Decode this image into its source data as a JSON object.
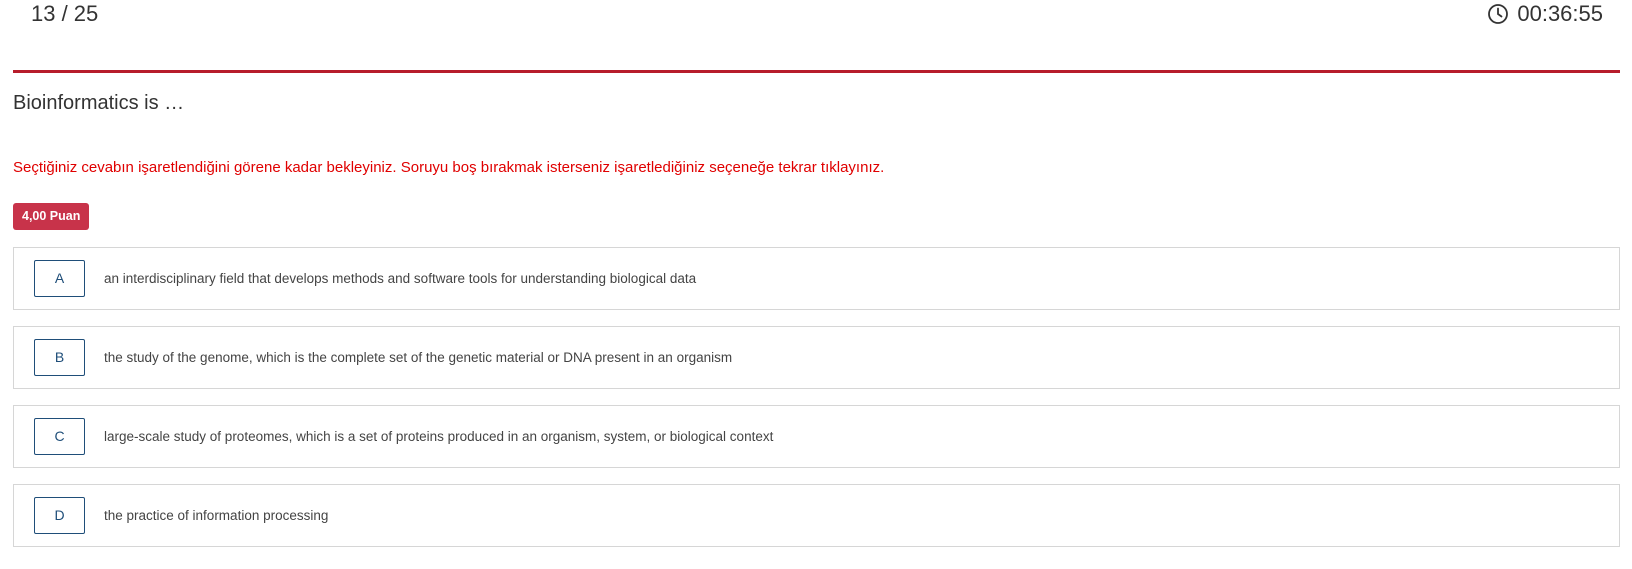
{
  "header": {
    "counter": "13 / 25",
    "timer": "00:36:55",
    "timer_icon": "clock-icon"
  },
  "question": {
    "text": "Bioinformatics is …",
    "instruction": "Seçtiğiniz cevabın işaretlendiğini görene kadar bekleyiniz. Soruyu boş bırakmak isterseniz işaretlediğiniz seçeneğe tekrar tıklayınız.",
    "points": "4,00 Puan"
  },
  "options": [
    {
      "letter": "A",
      "text": "an interdisciplinary field that develops methods and software tools for understanding biological data"
    },
    {
      "letter": "B",
      "text": "the study of the genome, which is the complete set of the genetic material or DNA present in an organism"
    },
    {
      "letter": "C",
      "text": "large-scale study of proteomes, which is a set of proteins produced in an organism, system, or biological context"
    },
    {
      "letter": "D",
      "text": "the practice of information processing"
    }
  ],
  "colors": {
    "accent_line": "#b71c2b",
    "warning_text": "#e00000",
    "badge_bg": "#c8334a",
    "option_letter": "#1f4e79"
  }
}
